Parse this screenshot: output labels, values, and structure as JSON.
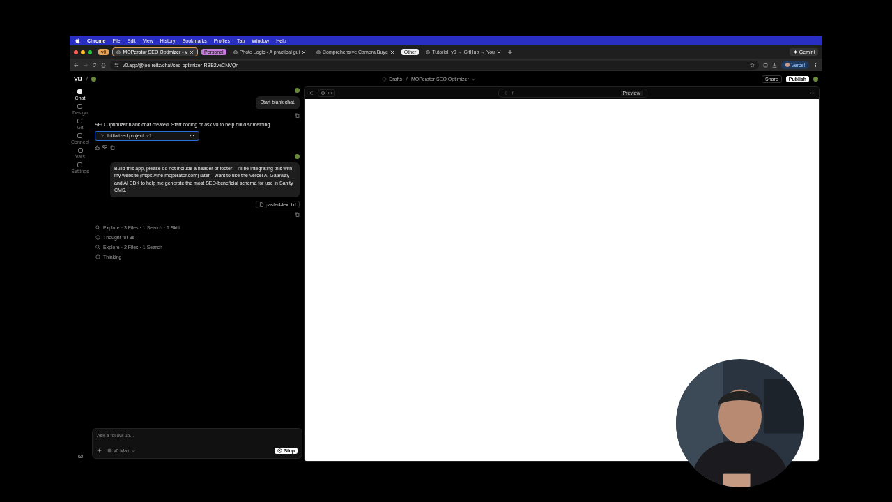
{
  "menu_bar": {
    "items": [
      "Chrome",
      "File",
      "Edit",
      "View",
      "History",
      "Bookmarks",
      "Profiles",
      "Tab",
      "Window",
      "Help"
    ]
  },
  "tabs": [
    {
      "kind": "group",
      "label": "v0",
      "color": "#e8a255"
    },
    {
      "kind": "tab",
      "title": "MOPerator SEO Optimizer - v",
      "selected": true
    },
    {
      "kind": "group",
      "label": "Personal",
      "color": "#c77ddb"
    },
    {
      "kind": "tab",
      "title": "Photo Logic - A practical gui",
      "selected": false
    },
    {
      "kind": "tab",
      "title": "Comprehensive Camera Buye",
      "selected": false
    },
    {
      "kind": "group",
      "label": "Other",
      "color": "#f2f2f2"
    },
    {
      "kind": "tab",
      "title": "Tutorial: v0 → GitHub → You",
      "selected": false
    }
  ],
  "gemini_button": "Gemini",
  "address_bar": {
    "url": "v0.app/@joe-reitz/chat/seo-optimizer-RBB2veCNVQn",
    "profile": "Vercel"
  },
  "app_header": {
    "breadcrumb": [
      "Drafts",
      "MOPerator SEO Optimizer"
    ],
    "share": "Share",
    "publish": "Publish"
  },
  "sidebar": {
    "items": [
      {
        "label": "Chat",
        "selected": true
      },
      {
        "label": "Design",
        "selected": false
      },
      {
        "label": "Git",
        "selected": false
      },
      {
        "label": "Connect",
        "selected": false
      },
      {
        "label": "Vars",
        "selected": false
      },
      {
        "label": "Settings",
        "selected": false
      }
    ]
  },
  "chat": {
    "messages": [
      {
        "kind": "user",
        "text": "Start blank chat."
      },
      {
        "kind": "assistant",
        "text": "SEO Optimizer blank chat created. Start coding or ask v0 to help build something.",
        "version": {
          "title": "Initialized project",
          "tag": "v1"
        }
      },
      {
        "kind": "user",
        "text": "Build this app, please do not include a header of footer – I'll be integrating this with my website (https://the-moperator.com) later. I want to use the Vercel AI Gateway and AI SDK to help me generate the most SEO-beneficial schema for use in Sanity CMS.",
        "attachment": "pasted-text.txt"
      }
    ],
    "steps": [
      {
        "kind": "search",
        "text": "Explore · 3 Files · 1 Search · 1 Skill"
      },
      {
        "kind": "thought",
        "text": "Thought for 3s"
      },
      {
        "kind": "search",
        "text": "Explore · 2 Files · 1 Search"
      },
      {
        "kind": "thought",
        "text": "Thinking"
      }
    ]
  },
  "composer": {
    "placeholder": "Ask a follow-up...",
    "model": "v0 Max",
    "stop": "Stop"
  },
  "preview": {
    "path": "/",
    "button": "Preview"
  }
}
